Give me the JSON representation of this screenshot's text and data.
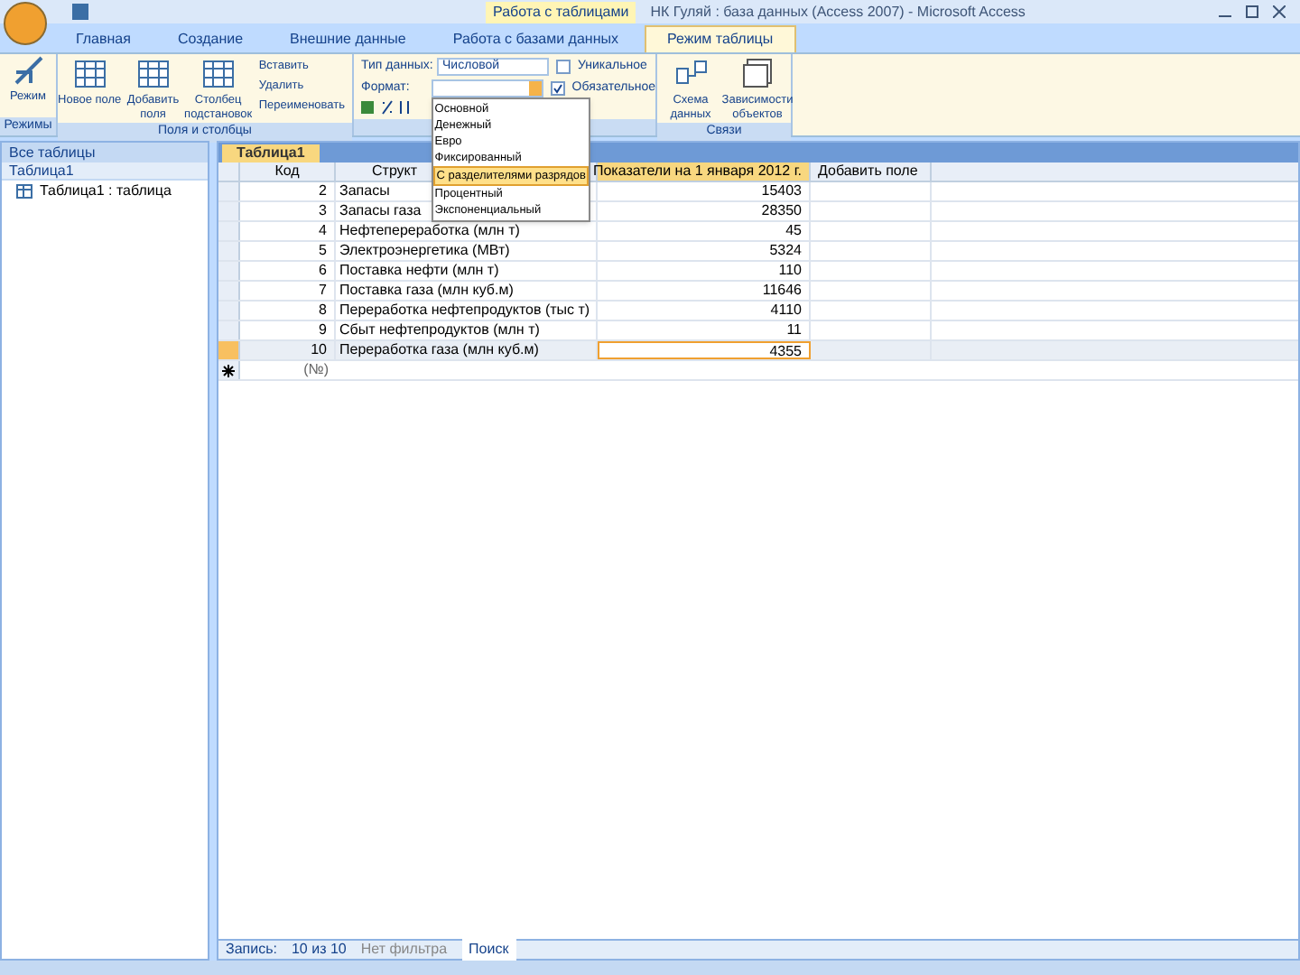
{
  "window": {
    "context_tab": "Работа с таблицами",
    "title": "НК Гуляй : база данных (Access 2007) - Microsoft Access"
  },
  "ribbon_tabs": [
    {
      "label": "Главная",
      "selected": false
    },
    {
      "label": "Создание",
      "selected": false
    },
    {
      "label": "Внешние данные",
      "selected": false
    },
    {
      "label": "Работа с базами данных",
      "selected": false
    },
    {
      "label": "Режим таблицы",
      "selected": true
    }
  ],
  "ribbon": {
    "views": {
      "button": "Режим",
      "group": "Режимы"
    },
    "fields": {
      "new_field": "Новое поле",
      "add_fields": "Добавить поля",
      "lookup_column": "Столбец подстановок",
      "insert": "Вставить",
      "delete": "Удалить",
      "rename": "Переименовать",
      "group": "Поля и столбцы"
    },
    "format": {
      "data_type_label": "Тип данных:",
      "data_type_value": "Числовой",
      "format_label": "Формат:",
      "unique": {
        "label": "Уникальное",
        "checked": false
      },
      "required": {
        "label": "Обязательное",
        "checked": true
      }
    },
    "relations": {
      "schema": "Схема данных",
      "dependencies": "Зависимости объектов",
      "group": "Связи"
    }
  },
  "format_dropdown": [
    {
      "label": "Основной",
      "selected": false
    },
    {
      "label": "Денежный",
      "selected": false
    },
    {
      "label": "Евро",
      "selected": false
    },
    {
      "label": "Фиксированный",
      "selected": false
    },
    {
      "label": "С разделителями разрядов",
      "selected": true
    },
    {
      "label": "Процентный",
      "selected": false
    },
    {
      "label": "Экспоненциальный",
      "selected": false
    }
  ],
  "nav_pane": {
    "title": "Все таблицы",
    "groups": [
      {
        "label": "Таблица1",
        "items": [
          "Таблица1 : таблица"
        ]
      }
    ]
  },
  "document_tab": "Таблица1",
  "table": {
    "columns": [
      "Код",
      "Структ",
      "Показатели на 1 января 2012 г.",
      "Добавить поле"
    ],
    "rows": [
      {
        "id": "2",
        "name": "Запасы",
        "value": "15403",
        "selected": false
      },
      {
        "id": "3",
        "name": "Запасы газа",
        "value": "28350",
        "selected": false
      },
      {
        "id": "4",
        "name": "Нефтепереработка (млн т)",
        "value": "45",
        "selected": false
      },
      {
        "id": "5",
        "name": "Электроэнергетика (МВт)",
        "value": "5324",
        "selected": false
      },
      {
        "id": "6",
        "name": "Поставка нефти (млн т)",
        "value": "110",
        "selected": false
      },
      {
        "id": "7",
        "name": "Поставка газа (млн куб.м)",
        "value": "11646",
        "selected": false
      },
      {
        "id": "8",
        "name": "Переработка нефтепродуктов (тыс т)",
        "value": "4110",
        "selected": false
      },
      {
        "id": "9",
        "name": "Сбыт нефтепродуктов (млн т)",
        "value": "11",
        "selected": false
      },
      {
        "id": "10",
        "name": "Переработка газа (млн куб.м)",
        "value": "4355",
        "selected": true
      }
    ],
    "new_row": "(№)"
  },
  "status_bar": {
    "record_label": "Запись:",
    "record": "10 из 10",
    "filter": "Нет фильтра",
    "search": "Поиск"
  }
}
